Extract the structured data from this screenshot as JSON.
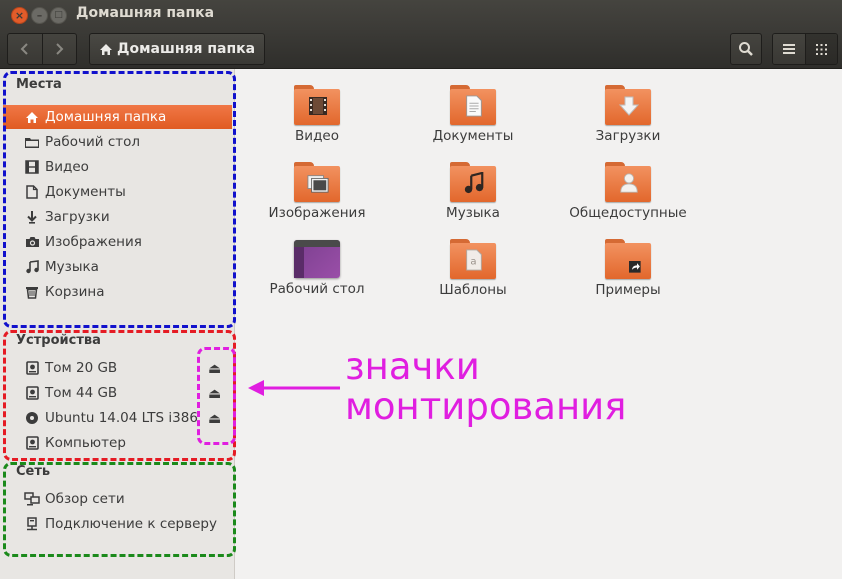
{
  "window": {
    "title": "Домашняя папка",
    "buttons": {
      "close": "×",
      "minimize": "–",
      "maximize": "□"
    }
  },
  "toolbar": {
    "back_icon": "chevron-left-icon",
    "forward_icon": "chevron-right-icon",
    "path_label": "Домашняя папка",
    "search_icon": "search-icon",
    "list_view_icon": "list-view-icon",
    "grid_view_icon": "grid-view-icon"
  },
  "sidebar": {
    "places_title": "Места",
    "places": [
      {
        "label": "Домашняя папка",
        "icon": "home-icon",
        "selected": true
      },
      {
        "label": "Рабочий стол",
        "icon": "folder-icon"
      },
      {
        "label": "Видео",
        "icon": "film-icon"
      },
      {
        "label": "Документы",
        "icon": "document-icon"
      },
      {
        "label": "Загрузки",
        "icon": "download-icon"
      },
      {
        "label": "Изображения",
        "icon": "camera-icon"
      },
      {
        "label": "Музыка",
        "icon": "music-icon"
      },
      {
        "label": "Корзина",
        "icon": "trash-icon"
      }
    ],
    "devices_title": "Устройства",
    "devices": [
      {
        "label": "Том 20 GB",
        "icon": "drive-icon",
        "eject": true
      },
      {
        "label": "Том 44 GB",
        "icon": "drive-icon",
        "eject": true
      },
      {
        "label": "Ubuntu 14.04 LTS i386",
        "icon": "disc-icon",
        "eject": true
      },
      {
        "label": "Компьютер",
        "icon": "drive-icon",
        "eject": false
      }
    ],
    "network_title": "Сеть",
    "network": [
      {
        "label": "Обзор сети",
        "icon": "network-icon"
      },
      {
        "label": "Подключение к серверу",
        "icon": "server-icon"
      }
    ]
  },
  "files": [
    {
      "name": "Видео",
      "emblem": "film-icon"
    },
    {
      "name": "Документы",
      "emblem": "document-icon"
    },
    {
      "name": "Загрузки",
      "emblem": "download-icon"
    },
    {
      "name": "Изображения",
      "emblem": "image-icon"
    },
    {
      "name": "Музыка",
      "emblem": "music-icon"
    },
    {
      "name": "Общедоступные",
      "emblem": "person-icon"
    },
    {
      "name": "Рабочий стол",
      "emblem": "desktop-icon"
    },
    {
      "name": "Шаблоны",
      "emblem": "template-icon"
    },
    {
      "name": "Примеры",
      "emblem": "link-icon"
    }
  ],
  "annotation": {
    "line1": "значки",
    "line2": "монтирования",
    "colors": {
      "places": "#1111cc",
      "devices": "#e51b24",
      "network": "#1b8a1b",
      "eject": "#e01ee0"
    }
  }
}
